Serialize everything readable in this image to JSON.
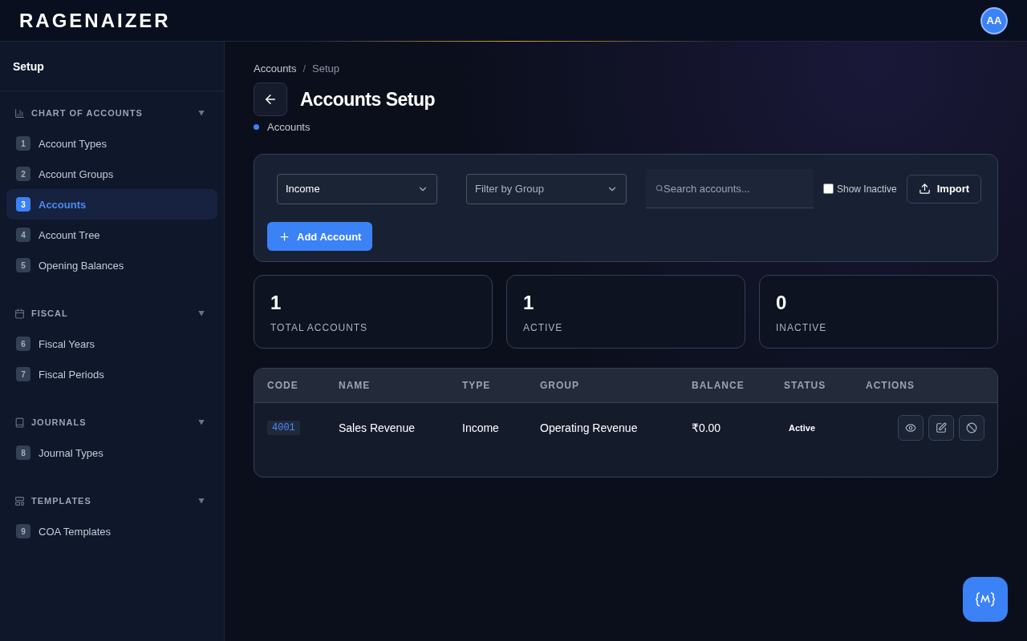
{
  "header": {
    "logo": "RAGENAIZER",
    "avatar": "AA"
  },
  "sidebar": {
    "title": "Setup",
    "sections": [
      {
        "kind": "chart",
        "label": "CHART OF ACCOUNTS",
        "expanded": true,
        "items": [
          {
            "num": "1",
            "label": "Account Types",
            "selected": false
          },
          {
            "num": "2",
            "label": "Account Groups",
            "selected": false
          },
          {
            "num": "3",
            "label": "Accounts",
            "selected": true
          },
          {
            "num": "4",
            "label": "Account Tree",
            "selected": false
          },
          {
            "num": "5",
            "label": "Opening Balances",
            "selected": false
          }
        ]
      },
      {
        "kind": "calendar",
        "label": "FISCAL",
        "expanded": true,
        "items": [
          {
            "num": "6",
            "label": "Fiscal Years",
            "selected": false
          },
          {
            "num": "7",
            "label": "Fiscal Periods",
            "selected": false
          }
        ]
      },
      {
        "kind": "book",
        "label": "JOURNALS",
        "expanded": true,
        "items": [
          {
            "num": "8",
            "label": "Journal Types",
            "selected": false
          }
        ]
      },
      {
        "kind": "layout",
        "label": "TEMPLATES",
        "expanded": true,
        "items": [
          {
            "num": "9",
            "label": "COA Templates",
            "selected": false
          }
        ]
      }
    ]
  },
  "breadcrumb": {
    "items": [
      "Accounts",
      "Setup"
    ],
    "separator": "/"
  },
  "title": "Accounts Setup",
  "subtitle": "Accounts",
  "filters": {
    "type_select": "Income",
    "group_select": "Filter by Group",
    "search": {
      "placeholder": "Search accounts..."
    },
    "show_inactive": {
      "label": "Show Inactive",
      "checked": false
    },
    "import": "Import",
    "add": "Add Account"
  },
  "stats": [
    {
      "value": "1",
      "label": "TOTAL ACCOUNTS"
    },
    {
      "value": "1",
      "label": "ACTIVE"
    },
    {
      "value": "0",
      "label": "INACTIVE"
    }
  ],
  "table": {
    "columns": [
      "CODE",
      "NAME",
      "TYPE",
      "GROUP",
      "BALANCE",
      "STATUS",
      "ACTIONS"
    ],
    "rows": [
      {
        "code": "4001",
        "name": "Sales Revenue",
        "type": "Income",
        "group": "Operating Revenue",
        "balance": "₹0.00",
        "status": "Active"
      }
    ]
  }
}
